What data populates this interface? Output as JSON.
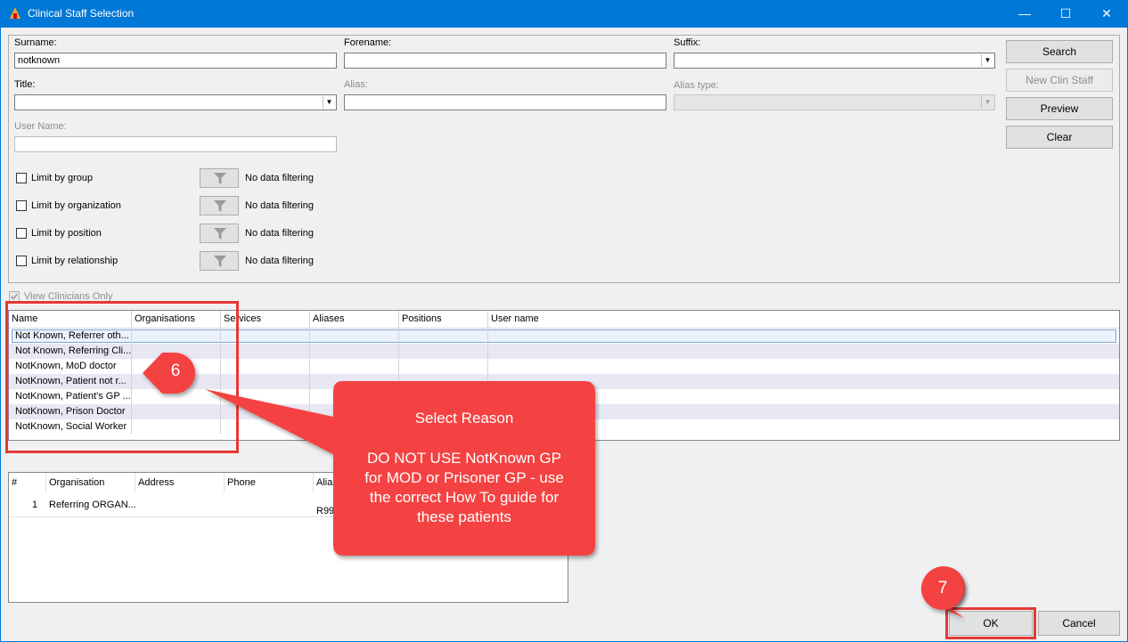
{
  "window": {
    "title": "Clinical Staff Selection",
    "minimize": "—",
    "maximize": "☐",
    "close": "✕"
  },
  "form": {
    "surname_label": "Surname:",
    "surname_value": "notknown",
    "forename_label": "Forename:",
    "forename_value": "",
    "suffix_label": "Suffix:",
    "suffix_value": "",
    "title_label": "Title:",
    "title_value": "",
    "alias_label": "Alias:",
    "alias_value": "",
    "alias_type_label": "Alias type:",
    "alias_type_value": "",
    "username_label": "User Name:",
    "username_value": ""
  },
  "buttons": {
    "search": "Search",
    "new_clin_staff": "New Clin Staff",
    "preview": "Preview",
    "clear": "Clear",
    "ok": "OK",
    "cancel": "Cancel"
  },
  "filters": [
    {
      "label": "Limit by group",
      "status": "No data filtering",
      "checked": false
    },
    {
      "label": "Limit by organization",
      "status": "No data filtering",
      "checked": false
    },
    {
      "label": "Limit by position",
      "status": "No data filtering",
      "checked": false
    },
    {
      "label": "Limit by relationship",
      "status": "No data filtering",
      "checked": false
    }
  ],
  "view_clinicians_only": {
    "label": "View Clinicians Only",
    "checked": true
  },
  "results": {
    "columns": [
      "Name",
      "Organisations",
      "Services",
      "Aliases",
      "Positions",
      "User name"
    ],
    "rows": [
      "Not Known, Referrer oth...",
      "Not Known, Referring Cli...",
      "NotKnown, MoD doctor",
      "NotKnown, Patient not r...",
      "NotKnown, Patient's GP ...",
      "NotKnown, Prison Doctor",
      "NotKnown, Social Worker"
    ]
  },
  "organisations": {
    "columns": [
      "#",
      "Organisation",
      "Address",
      "Phone",
      "Alia"
    ],
    "rows": [
      {
        "num": "1",
        "organisation": "Referring ORGAN...",
        "alias": "R99"
      }
    ]
  },
  "annotations": {
    "step6": "6",
    "step7": "7",
    "callout_line1": "Select Reason",
    "callout_line2": "DO NOT USE NotKnown GP",
    "callout_line3": "for MOD or Prisoner GP - use",
    "callout_line4": "the correct How To guide for",
    "callout_line5": "these patients",
    "accent_color": "#f44242"
  }
}
